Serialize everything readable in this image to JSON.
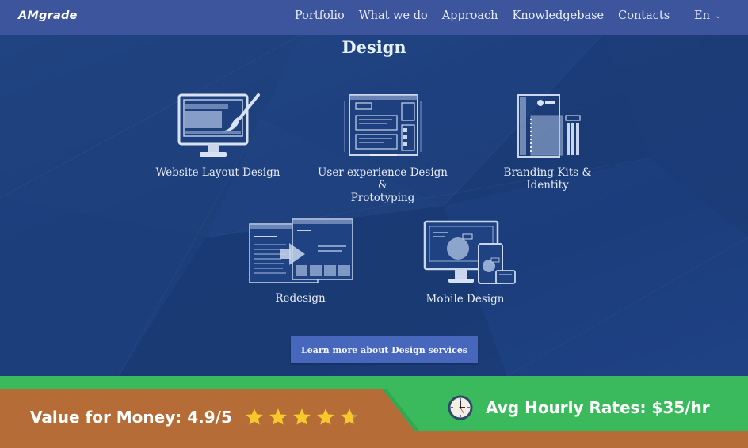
{
  "header": {
    "logo": "AMgrade",
    "nav": [
      "Portfolio",
      "What we do",
      "Approach",
      "Knowledgebase",
      "Contacts"
    ],
    "language": "En",
    "language_icon": "chevron-down-icon"
  },
  "main": {
    "title": "Design",
    "services": [
      {
        "label": "Website Layout Design",
        "icon": "monitor-paintbrush-icon"
      },
      {
        "label_line1": "User experience Design &",
        "label_line2": "Prototyping",
        "icon": "wireframe-icon"
      },
      {
        "label": "Branding Kits & Identity",
        "icon": "notebook-pencils-icon"
      },
      {
        "label": "Redesign",
        "icon": "redesign-windows-icon"
      },
      {
        "label": "Mobile Design",
        "icon": "responsive-devices-icon"
      }
    ],
    "cta_label": "Learn more about Design services"
  },
  "footer_banner": {
    "value_for_money_label": "Value for Money: 4.9/5",
    "rating": 4.9,
    "rating_max": 5,
    "hourly_rate_label": "Avg Hourly Rates: $35/hr",
    "colors": {
      "green": "#3aba5d",
      "brown": "#b56c36",
      "star": "#f6c82b"
    }
  }
}
